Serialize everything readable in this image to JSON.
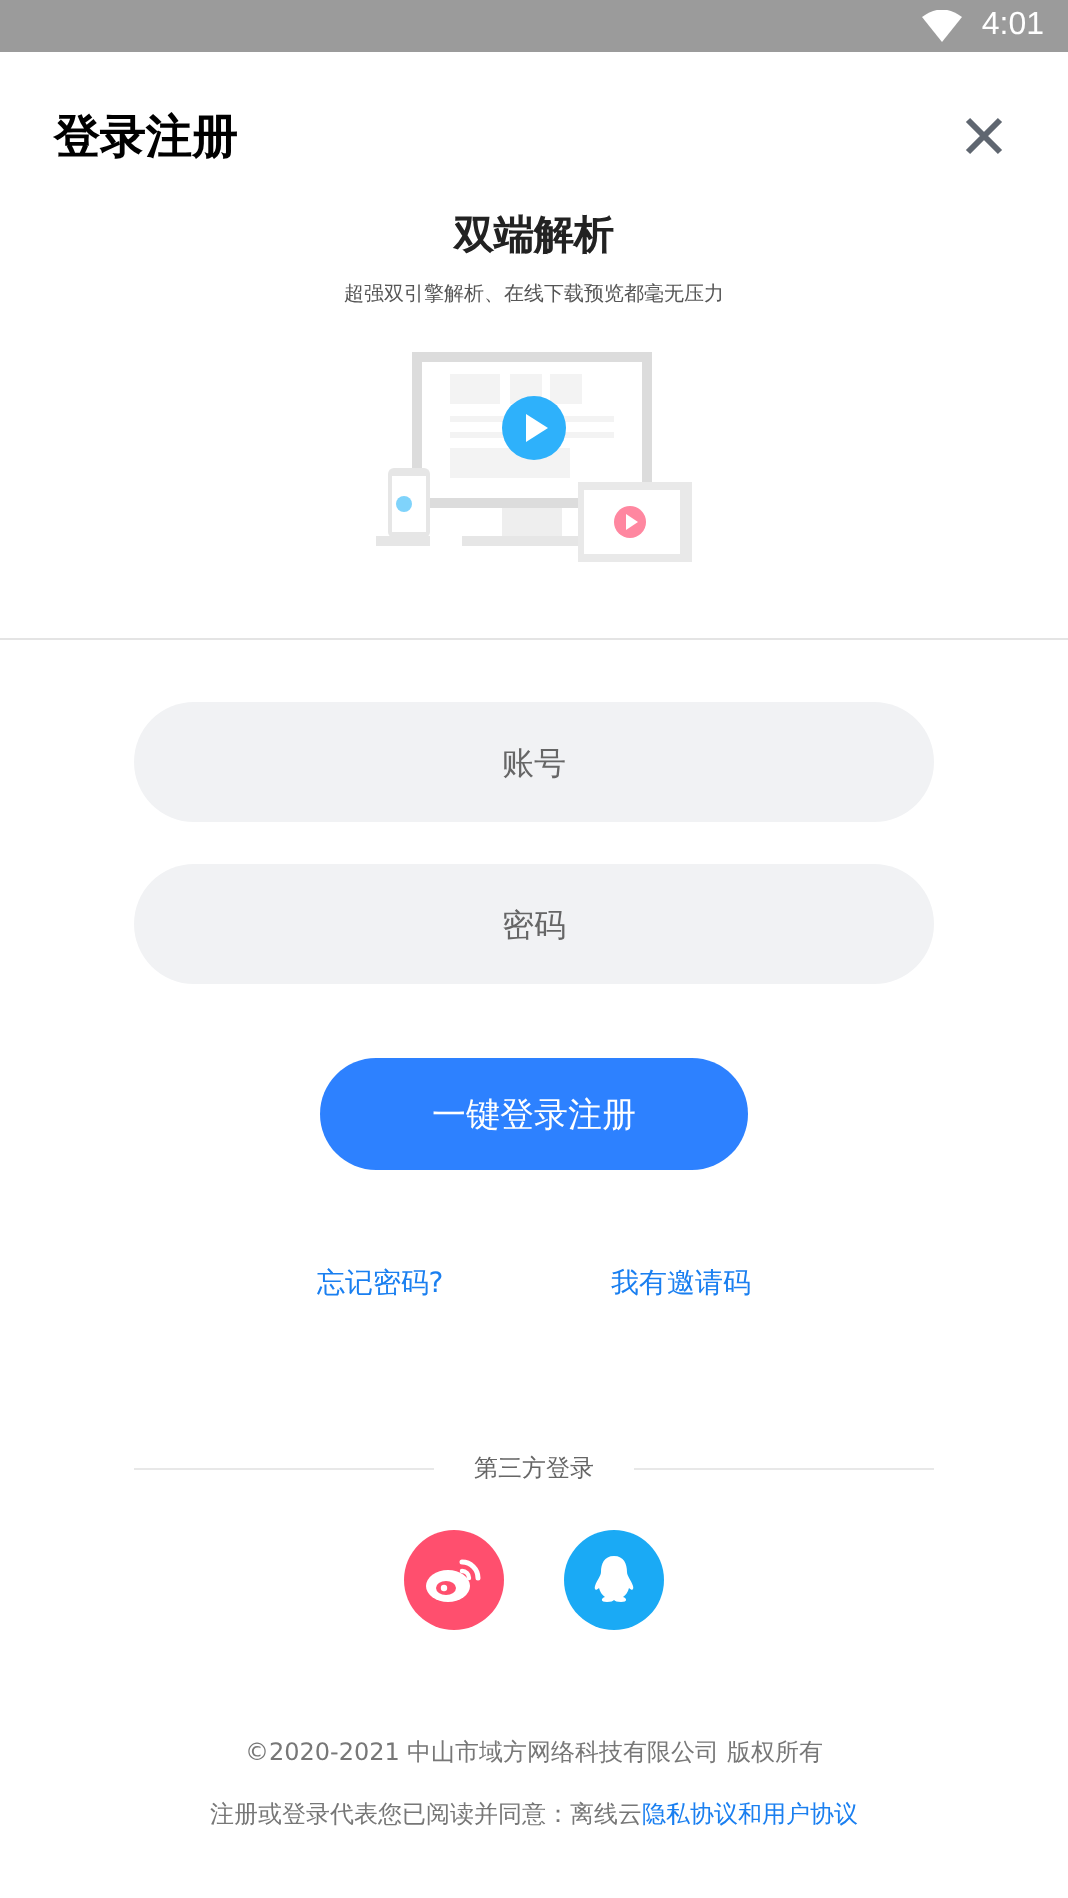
{
  "status_bar": {
    "time": "4:01"
  },
  "header": {
    "title": "登录注册"
  },
  "hero": {
    "title": "双端解析",
    "subtitle": "超强双引擎解析、在线下载预览都毫无压力"
  },
  "form": {
    "fields": [
      {
        "placeholder": "账号"
      },
      {
        "placeholder": "密码"
      }
    ],
    "submit": "一键登录注册",
    "links": [
      "忘记密码?",
      "我有邀请码"
    ]
  },
  "third_party": {
    "label": "第三方登录",
    "providers": [
      {
        "kind": "weibo",
        "color": "#ff4f6e"
      },
      {
        "kind": "qq",
        "color": "#1aaaf5"
      }
    ]
  },
  "footer": {
    "copyright": "©2020-2021 中山市域方网络科技有限公司 版权所有",
    "agreement": "注册或登录代表您已阅读并同意：离线云",
    "agreement_link": "隐私协议和用户协议"
  }
}
